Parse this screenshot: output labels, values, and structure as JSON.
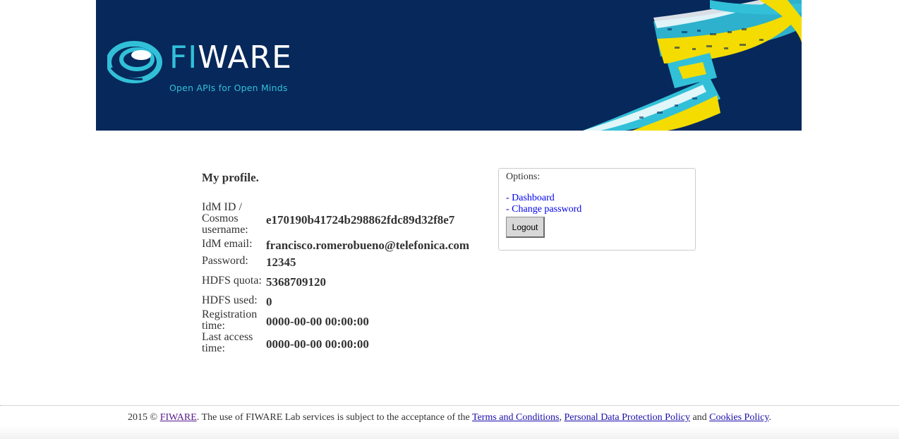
{
  "header": {
    "logo_prefix": "FI",
    "logo_suffix": "WARE",
    "tagline": "Open APIs for Open Minds",
    "brand_colors": {
      "background": "#06285a",
      "accent": "#32c0d8",
      "ribbon_yellow": "#f4dc00"
    }
  },
  "profile": {
    "title": "My profile.",
    "rows": [
      {
        "label": "IdM ID / Cosmos username:",
        "value": "e170190b41724b298862fdc89d32f8e7"
      },
      {
        "label": "IdM email:",
        "value": "francisco.romerobueno@telefonica.com"
      },
      {
        "label": "Password:",
        "value": "12345"
      },
      {
        "label": "HDFS quota:",
        "value": "5368709120"
      },
      {
        "label": "HDFS used:",
        "value": "0"
      },
      {
        "label": "Registration time:",
        "value": "0000-00-00 00:00:00"
      },
      {
        "label": "Last access time:",
        "value": "0000-00-00 00:00:00"
      }
    ]
  },
  "options": {
    "title": "Options:",
    "dashboard_link": "- Dashboard",
    "change_password_link": "- Change password",
    "logout_label": "Logout"
  },
  "footer": {
    "prefix": "2015 © ",
    "fiware_link": "FIWARE",
    "middle": ". The use of FIWARE Lab services is subject to the acceptance of the ",
    "terms_link": "Terms and Conditions",
    "sep": ", ",
    "privacy_link": "Personal Data Protection Policy",
    "and": " and ",
    "cookies_link": "Cookies Policy",
    "end": "."
  }
}
